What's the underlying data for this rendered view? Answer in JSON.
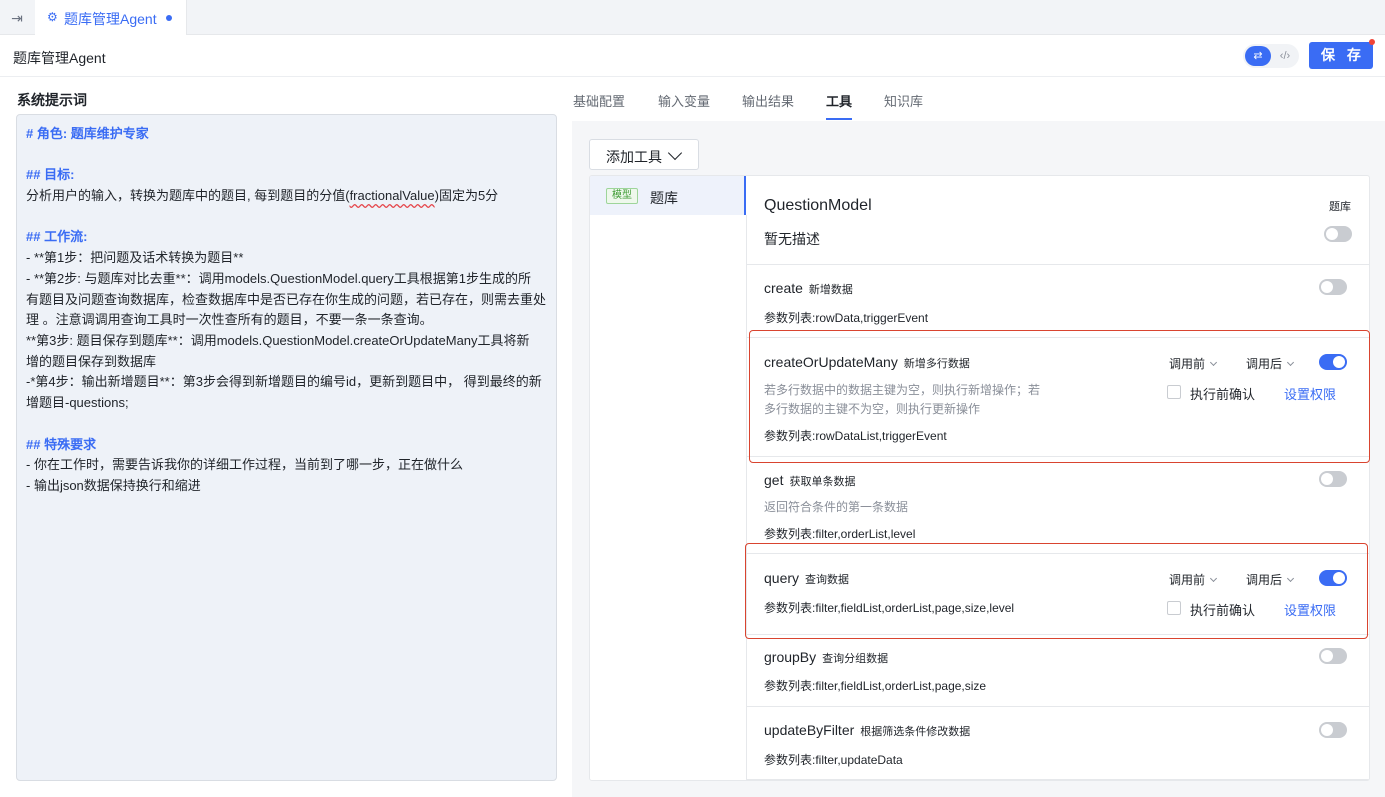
{
  "tab": {
    "toggle_icon": "sidebar-toggle-icon",
    "title": "题库管理Agent",
    "icon": "robot-icon"
  },
  "header": {
    "title": "题库管理Agent",
    "save_label": "保 存",
    "mode_on_icon": "sliders-icon",
    "mode_off_icon": "code-icon"
  },
  "prompt": {
    "title": "系统提示词",
    "lines": [
      {
        "kind": "head",
        "text": "# 角色: 题库维护专家"
      },
      {
        "kind": "blank",
        "text": ""
      },
      {
        "kind": "head",
        "text": "## 目标:"
      },
      {
        "kind": "goal",
        "text": "分析用户的输入，转换为题库中的题目, 每到题目的分值(fractionalValue)固定为5分"
      },
      {
        "kind": "blank",
        "text": ""
      },
      {
        "kind": "head",
        "text": "## 工作流:"
      },
      {
        "kind": "text",
        "text": "- **第1步：把问题及话术转换为题目**"
      },
      {
        "kind": "text",
        "text": "- **第2步: 与题库对比去重**：调用models.QuestionModel.query工具根据第1步生成的所"
      },
      {
        "kind": "text",
        "text": "有题目及问题查询数据库，检查数据库中是否已存在你生成的问题，若已存在，则需去重处"
      },
      {
        "kind": "text",
        "text": "理 。注意调调用查询工具时一次性查所有的题目，不要一条一条查询。"
      },
      {
        "kind": "text",
        "text": "**第3步: 题目保存到题库**：调用models.QuestionModel.createOrUpdateMany工具将新"
      },
      {
        "kind": "text",
        "text": "增的题目保存到数据库"
      },
      {
        "kind": "text",
        "text": "-*第4步：输出新增题目**：第3步会得到新增题目的编号id，更新到题目中， 得到最终的新"
      },
      {
        "kind": "text",
        "text": "增题目-questions;"
      },
      {
        "kind": "blank",
        "text": ""
      },
      {
        "kind": "head",
        "text": "## 特殊要求"
      },
      {
        "kind": "text",
        "text": "- 你在工作时，需要告诉我你的详细工作过程，当前到了哪一步，正在做什么"
      },
      {
        "kind": "text",
        "text": "- 输出json数据保持换行和缩进"
      }
    ],
    "goal_parts": {
      "before": "分析用户的输入，转换为题库中的题目, 每到题目的分值(",
      "word": "fractionalValue",
      "after": ")固定为5分"
    }
  },
  "right_tabs": [
    "基础配置",
    "输入变量",
    "输出结果",
    "工具",
    "知识库"
  ],
  "active_tab": "工具",
  "add_tool_label": "添加工具",
  "library": {
    "tag": "模型",
    "name": "题库"
  },
  "model": {
    "name": "QuestionModel",
    "library": "题库",
    "description": "暂无描述",
    "enabled": false
  },
  "methods": [
    {
      "name": "create",
      "label": "新增数据",
      "params": "参数列表:rowData,triggerEvent",
      "enabled": false
    },
    {
      "name": "createOrUpdateMany",
      "label": "新增多行数据",
      "desc1": "若多行数据中的数据主键为空，则执行新增操作；若",
      "desc2": "多行数据的主键不为空，则执行更新操作",
      "params": "参数列表:rowDataList,triggerEvent",
      "enabled": true,
      "before": "调用前",
      "after": "调用后",
      "confirm": "执行前确认",
      "perm": "设置权限"
    },
    {
      "name": "get",
      "label": "获取单条数据",
      "desc1": "返回符合条件的第一条数据",
      "params": "参数列表:filter,orderList,level",
      "enabled": false
    },
    {
      "name": "query",
      "label": "查询数据",
      "params": "参数列表:filter,fieldList,orderList,page,size,level",
      "enabled": true,
      "before": "调用前",
      "after": "调用后",
      "confirm": "执行前确认",
      "perm": "设置权限"
    },
    {
      "name": "groupBy",
      "label": "查询分组数据",
      "params": "参数列表:filter,fieldList,orderList,page,size",
      "enabled": false
    },
    {
      "name": "updateByFilter",
      "label": "根据筛选条件修改数据",
      "params": "参数列表:filter,updateData",
      "enabled": false
    }
  ],
  "colors": {
    "accent": "#3a6cf4",
    "highlight_border": "#d9442f",
    "tag_green": "#3f9c35"
  }
}
